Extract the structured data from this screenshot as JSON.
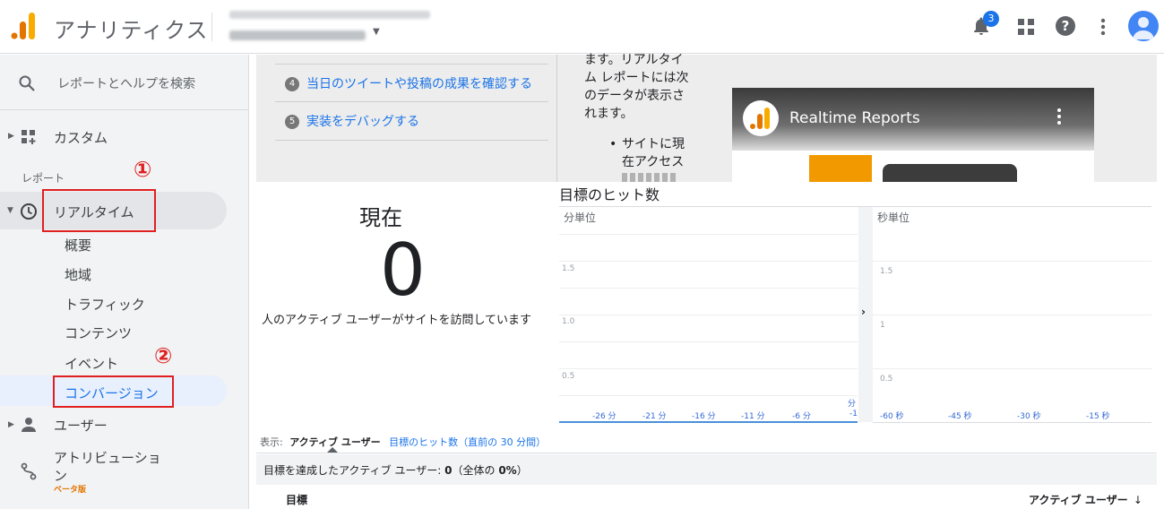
{
  "header": {
    "app_title": "アナリティクス",
    "notifications_count": "3"
  },
  "sidebar": {
    "search_placeholder": "レポートとヘルプを検索",
    "custom_label": "カスタム",
    "section_label": "レポート",
    "realtime_label": "リアルタイム",
    "realtime_items": [
      "概要",
      "地域",
      "トラフィック",
      "コンテンツ",
      "イベント",
      "コンバージョン"
    ],
    "users_label": "ユーザー",
    "attribution_label_line1": "アトリビューショ",
    "attribution_label_line2": "ン",
    "attribution_badge": "ベータ版",
    "annotation_1": "①",
    "annotation_2": "②"
  },
  "top_panel": {
    "steps": [
      {
        "num": "4",
        "text": "当日のツイートや投稿の成果を確認する"
      },
      {
        "num": "5",
        "text": "実装をデバッグする"
      }
    ],
    "desc_lines": [
      "ます。リアルタイ",
      "ム レポートには次",
      "のデータが表示さ",
      "れます。"
    ],
    "bullet_lines": [
      "サイトに現",
      "在アクセス"
    ],
    "video_title": "Realtime Reports"
  },
  "now": {
    "label": "現在",
    "count": "0",
    "description": "人のアクティブ ユーザーがサイトを訪問しています"
  },
  "goal_hits": {
    "title": "目標のヒット数",
    "per_minute": {
      "label": "分単位",
      "y_ticks": [
        "1.5",
        "1.0",
        "0.5"
      ],
      "x_ticks": [
        "-26 分",
        "-21 分",
        "-16 分",
        "-11 分",
        "-6 分"
      ],
      "edge_tick_top": "分",
      "edge_tick_bottom": "-1"
    },
    "per_second": {
      "label": "秒単位",
      "y_ticks": [
        "1.5",
        "1",
        "0.5"
      ],
      "x_ticks": [
        "-60 秒",
        "-45 秒",
        "-30 秒",
        "-15 秒"
      ]
    }
  },
  "view_tabs": {
    "prefix": "表示:",
    "active": "アクティブ ユーザー",
    "other": "目標のヒット数（直前の 30 分間）"
  },
  "summary": {
    "text_prefix": "目標を達成したアクティブ ユーザー: ",
    "count": "0",
    "text_middle": "（全体の ",
    "percent": "0%",
    "text_suffix": "）"
  },
  "table": {
    "col_goal": "目標",
    "col_users": "アクティブ ユーザー"
  }
}
